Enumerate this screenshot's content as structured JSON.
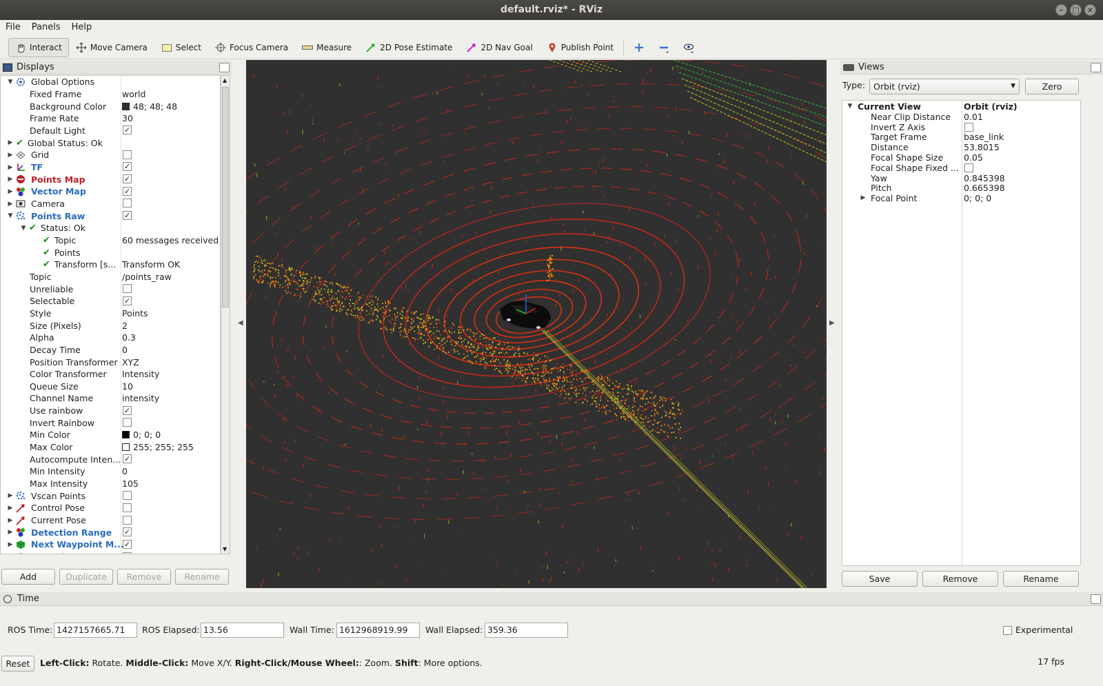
{
  "window": {
    "title": "default.rviz* - RViz"
  },
  "menu": [
    "File",
    "Panels",
    "Help"
  ],
  "toolbar": {
    "tools": [
      "Interact",
      "Move Camera",
      "Select",
      "Focus Camera",
      "Measure",
      "2D Pose Estimate",
      "2D Nav Goal",
      "Publish Point"
    ],
    "active": "Interact"
  },
  "displays": {
    "title": "Displays",
    "rows": [
      {
        "label": "Global Options",
        "value": ""
      },
      {
        "label": "Fixed Frame",
        "value": "world"
      },
      {
        "label": "Background Color",
        "value": "48; 48; 48"
      },
      {
        "label": "Frame Rate",
        "value": "30"
      },
      {
        "label": "Default Light",
        "value": ""
      },
      {
        "label": "Global Status: Ok",
        "value": ""
      },
      {
        "label": "Grid",
        "value": ""
      },
      {
        "label": "TF",
        "value": ""
      },
      {
        "label": "Points Map",
        "value": ""
      },
      {
        "label": "Vector Map",
        "value": ""
      },
      {
        "label": "Camera",
        "value": ""
      },
      {
        "label": "Points Raw",
        "value": ""
      },
      {
        "label": "Status: Ok",
        "value": ""
      },
      {
        "label": "Topic",
        "value": "60 messages received"
      },
      {
        "label": "Points",
        "value": ""
      },
      {
        "label": "Transform [s...",
        "value": "Transform OK"
      },
      {
        "label": "Topic",
        "value": "/points_raw"
      },
      {
        "label": "Unreliable",
        "value": ""
      },
      {
        "label": "Selectable",
        "value": ""
      },
      {
        "label": "Style",
        "value": "Points"
      },
      {
        "label": "Size (Pixels)",
        "value": "2"
      },
      {
        "label": "Alpha",
        "value": "0.3"
      },
      {
        "label": "Decay Time",
        "value": "0"
      },
      {
        "label": "Position Transformer",
        "value": "XYZ"
      },
      {
        "label": "Color Transformer",
        "value": "Intensity"
      },
      {
        "label": "Queue Size",
        "value": "10"
      },
      {
        "label": "Channel Name",
        "value": "intensity"
      },
      {
        "label": "Use rainbow",
        "value": ""
      },
      {
        "label": "Invert Rainbow",
        "value": ""
      },
      {
        "label": "Min Color",
        "value": "0; 0; 0"
      },
      {
        "label": "Max Color",
        "value": "255; 255; 255"
      },
      {
        "label": "Autocompute Inten...",
        "value": ""
      },
      {
        "label": "Min Intensity",
        "value": "0"
      },
      {
        "label": "Max Intensity",
        "value": "105"
      },
      {
        "label": "Vscan Points",
        "value": ""
      },
      {
        "label": "Control Pose",
        "value": ""
      },
      {
        "label": "Current Pose",
        "value": ""
      },
      {
        "label": "Detection Range",
        "value": ""
      },
      {
        "label": "Next Waypoint M...",
        "value": ""
      },
      {
        "label": "PP Trajectory Ma...",
        "value": ""
      }
    ],
    "buttons": [
      "Add",
      "Duplicate",
      "Remove",
      "Rename"
    ]
  },
  "views": {
    "title": "Views",
    "type_label": "Type:",
    "type_value": "Orbit (rviz)",
    "zero_label": "Zero",
    "rows": [
      {
        "label": "Current View",
        "value": "Orbit (rviz)"
      },
      {
        "label": "Near Clip Distance",
        "value": "0.01"
      },
      {
        "label": "Invert Z Axis",
        "value": ""
      },
      {
        "label": "Target Frame",
        "value": "base_link"
      },
      {
        "label": "Distance",
        "value": "53.8015"
      },
      {
        "label": "Focal Shape Size",
        "value": "0.05"
      },
      {
        "label": "Focal Shape Fixed ...",
        "value": ""
      },
      {
        "label": "Yaw",
        "value": "0.845398"
      },
      {
        "label": "Pitch",
        "value": "0.665398"
      },
      {
        "label": "Focal Point",
        "value": "0; 0; 0"
      }
    ],
    "buttons": [
      "Save",
      "Remove",
      "Rename"
    ]
  },
  "time": {
    "title": "Time",
    "ros_time_label": "ROS Time:",
    "ros_time": "1427157665.71",
    "ros_elapsed_label": "ROS Elapsed:",
    "ros_elapsed": "13.56",
    "wall_time_label": "Wall Time:",
    "wall_time": "1612968919.99",
    "wall_elapsed_label": "Wall Elapsed:",
    "wall_elapsed": "359.36",
    "experimental_label": "Experimental"
  },
  "status": {
    "reset_label": "Reset",
    "left_click": "Left-Click:",
    "left_click_desc": " Rotate. ",
    "middle_click": "Middle-Click:",
    "middle_click_desc": " Move X/Y. ",
    "right_click": "Right-Click/Mouse Wheel:",
    "right_click_desc": ": Zoom. ",
    "shift": "Shift",
    "shift_desc": ": More options.",
    "fps": "17 fps"
  },
  "colors": {
    "background": "#303030",
    "points_near": "#d82818",
    "points_far": "#a8c020",
    "link_blue": "#2a6cc0",
    "error_red": "#c0202a",
    "ok_green": "#1d8a1d"
  }
}
